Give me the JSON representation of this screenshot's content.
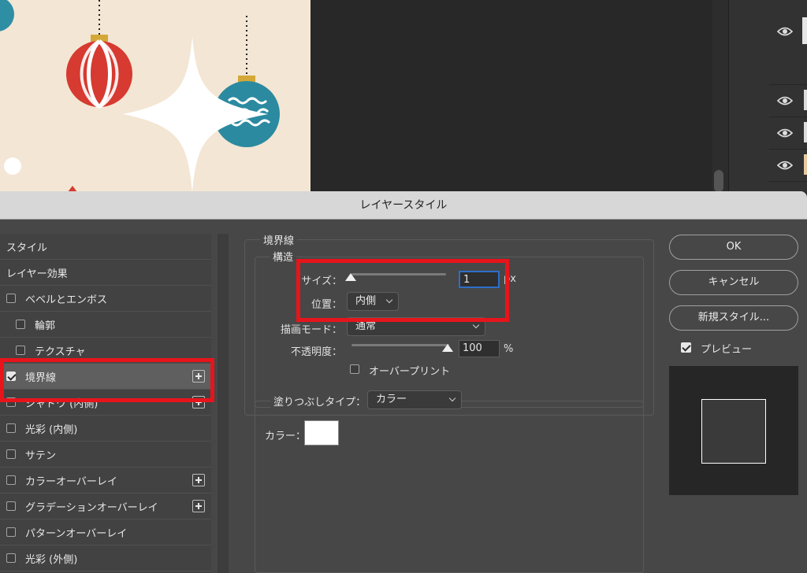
{
  "window": {
    "title": "レイヤースタイル"
  },
  "styles_list": {
    "items": [
      {
        "label": "スタイル",
        "type": "header"
      },
      {
        "label": "レイヤー効果",
        "type": "header"
      },
      {
        "label": "ベベルとエンボス",
        "checked": false
      },
      {
        "label": "輪郭",
        "checked": false,
        "indent": true
      },
      {
        "label": "テクスチャ",
        "checked": false,
        "indent": true
      },
      {
        "label": "境界線",
        "checked": true,
        "selected": true,
        "plus": true
      },
      {
        "label": "シャドウ (内側)",
        "checked": false,
        "plus": true
      },
      {
        "label": "光彩 (内側)",
        "checked": false
      },
      {
        "label": "サテン",
        "checked": false
      },
      {
        "label": "カラーオーバーレイ",
        "checked": false,
        "plus": true
      },
      {
        "label": "グラデーションオーバーレイ",
        "checked": false,
        "plus": true
      },
      {
        "label": "パターンオーバーレイ",
        "checked": false
      },
      {
        "label": "光彩 (外側)",
        "checked": false
      }
    ]
  },
  "stroke": {
    "section_title": "境界線",
    "structure_title": "構造",
    "size_label": "サイズ：",
    "size_value": "1",
    "size_unit": "px",
    "position_label": "位置：",
    "position_value": "内側",
    "blend_label": "描画モード：",
    "blend_value": "通常",
    "opacity_label": "不透明度：",
    "opacity_value": "100",
    "opacity_unit": "%",
    "overprint_label": "オーバープリント",
    "overprint_checked": false,
    "fill_type_label": "塗りつぶしタイプ：",
    "fill_type_value": "カラー",
    "color_label": "カラー：",
    "color_value": "#ffffff"
  },
  "buttons": {
    "ok": "OK",
    "cancel": "キャンセル",
    "new_style": "新規スタイル..."
  },
  "preview": {
    "label": "プレビュー",
    "checked": true
  },
  "colors": {
    "annotation": "#e8141b",
    "focus": "#2d6ec9"
  }
}
